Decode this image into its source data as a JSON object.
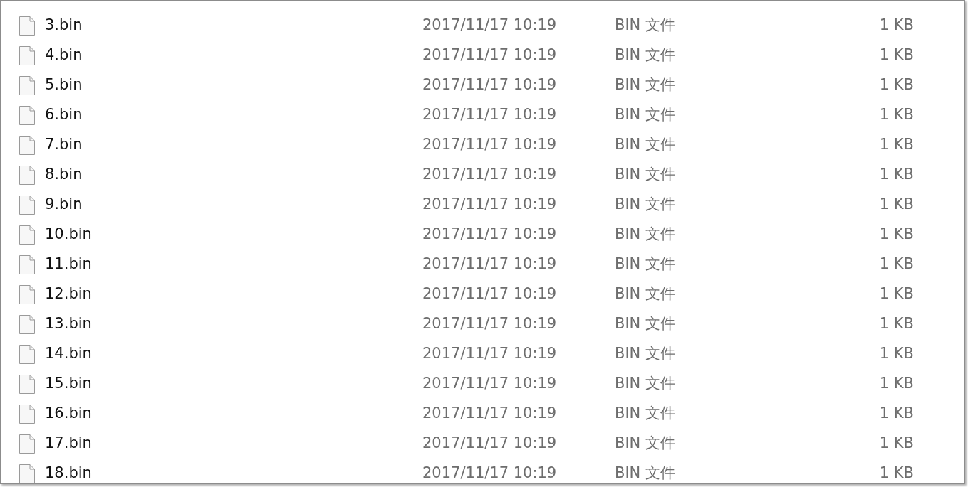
{
  "files": [
    {
      "name": "3.bin",
      "modified": "2017/11/17 10:19",
      "type": "BIN 文件",
      "size": "1 KB"
    },
    {
      "name": "4.bin",
      "modified": "2017/11/17 10:19",
      "type": "BIN 文件",
      "size": "1 KB"
    },
    {
      "name": "5.bin",
      "modified": "2017/11/17 10:19",
      "type": "BIN 文件",
      "size": "1 KB"
    },
    {
      "name": "6.bin",
      "modified": "2017/11/17 10:19",
      "type": "BIN 文件",
      "size": "1 KB"
    },
    {
      "name": "7.bin",
      "modified": "2017/11/17 10:19",
      "type": "BIN 文件",
      "size": "1 KB"
    },
    {
      "name": "8.bin",
      "modified": "2017/11/17 10:19",
      "type": "BIN 文件",
      "size": "1 KB"
    },
    {
      "name": "9.bin",
      "modified": "2017/11/17 10:19",
      "type": "BIN 文件",
      "size": "1 KB"
    },
    {
      "name": "10.bin",
      "modified": "2017/11/17 10:19",
      "type": "BIN 文件",
      "size": "1 KB"
    },
    {
      "name": "11.bin",
      "modified": "2017/11/17 10:19",
      "type": "BIN 文件",
      "size": "1 KB"
    },
    {
      "name": "12.bin",
      "modified": "2017/11/17 10:19",
      "type": "BIN 文件",
      "size": "1 KB"
    },
    {
      "name": "13.bin",
      "modified": "2017/11/17 10:19",
      "type": "BIN 文件",
      "size": "1 KB"
    },
    {
      "name": "14.bin",
      "modified": "2017/11/17 10:19",
      "type": "BIN 文件",
      "size": "1 KB"
    },
    {
      "name": "15.bin",
      "modified": "2017/11/17 10:19",
      "type": "BIN 文件",
      "size": "1 KB"
    },
    {
      "name": "16.bin",
      "modified": "2017/11/17 10:19",
      "type": "BIN 文件",
      "size": "1 KB"
    },
    {
      "name": "17.bin",
      "modified": "2017/11/17 10:19",
      "type": "BIN 文件",
      "size": "1 KB"
    },
    {
      "name": "18.bin",
      "modified": "2017/11/17 10:19",
      "type": "BIN 文件",
      "size": "1 KB"
    }
  ]
}
